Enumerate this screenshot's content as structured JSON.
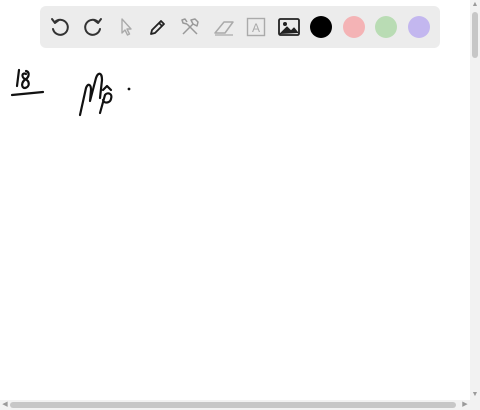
{
  "toolbar": {
    "tools": [
      {
        "name": "undo-icon"
      },
      {
        "name": "redo-icon"
      },
      {
        "name": "select-pointer-icon"
      },
      {
        "name": "pen-icon"
      },
      {
        "name": "tools-icon"
      },
      {
        "name": "eraser-icon"
      },
      {
        "name": "text-icon",
        "glyph": "A"
      },
      {
        "name": "image-icon"
      }
    ],
    "colors": [
      {
        "name": "black",
        "hex": "#000000"
      },
      {
        "name": "pink",
        "hex": "#f4b3b5"
      },
      {
        "name": "green",
        "hex": "#b9dcb4"
      },
      {
        "name": "purple",
        "hex": "#c3b7ef"
      }
    ]
  },
  "canvas": {
    "background": "#ffffff",
    "ink_color": "#111111"
  }
}
